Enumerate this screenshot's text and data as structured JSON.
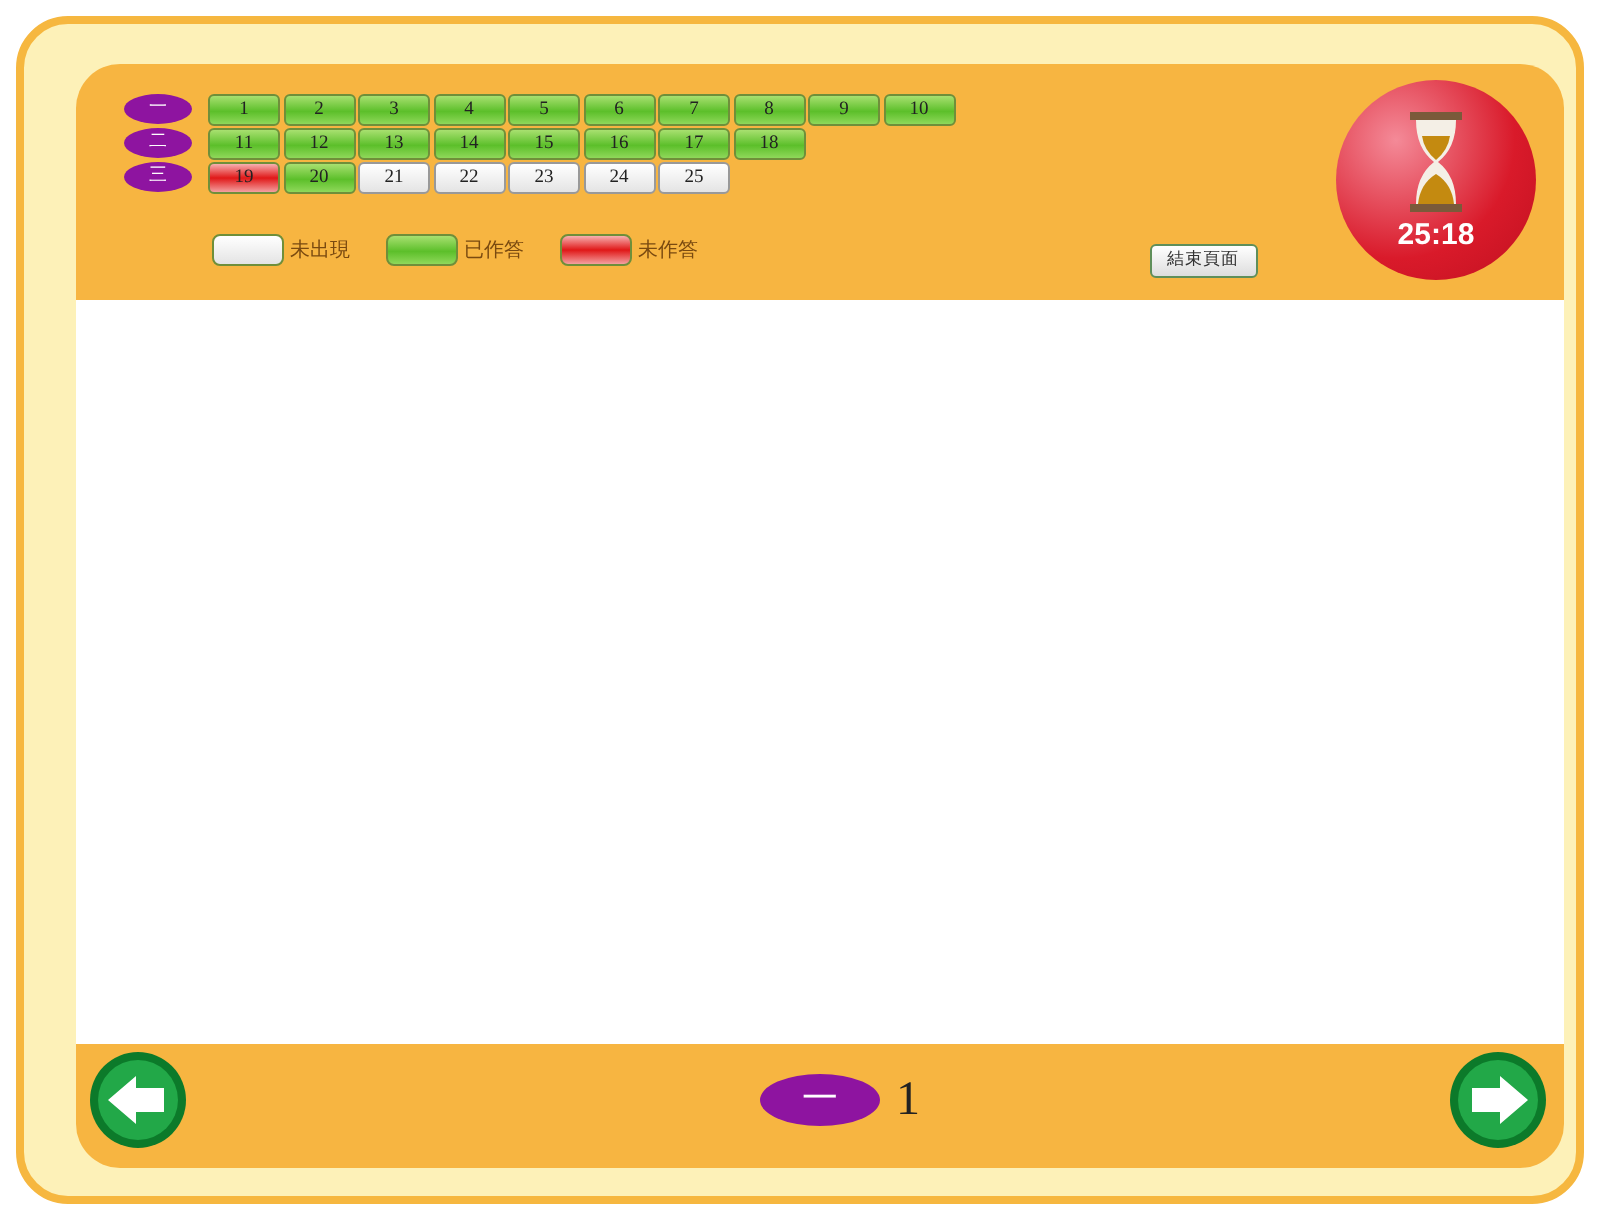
{
  "sections": [
    {
      "label": "一",
      "questions": [
        {
          "number": "1",
          "kind": "answered"
        },
        {
          "number": "2",
          "kind": "answered"
        },
        {
          "number": "3",
          "kind": "answered"
        },
        {
          "number": "4",
          "kind": "answered"
        },
        {
          "number": "5",
          "kind": "answered"
        },
        {
          "number": "6",
          "kind": "answered"
        },
        {
          "number": "7",
          "kind": "answered"
        },
        {
          "number": "8",
          "kind": "answered"
        },
        {
          "number": "9",
          "kind": "answered"
        },
        {
          "number": "10",
          "kind": "answered"
        }
      ]
    },
    {
      "label": "二",
      "questions": [
        {
          "number": "11",
          "kind": "answered"
        },
        {
          "number": "12",
          "kind": "answered"
        },
        {
          "number": "13",
          "kind": "answered"
        },
        {
          "number": "14",
          "kind": "answered"
        },
        {
          "number": "15",
          "kind": "answered"
        },
        {
          "number": "16",
          "kind": "answered"
        },
        {
          "number": "17",
          "kind": "answered"
        },
        {
          "number": "18",
          "kind": "answered"
        }
      ]
    },
    {
      "label": "三",
      "questions": [
        {
          "number": "19",
          "kind": "unanswered"
        },
        {
          "number": "20",
          "kind": "answered"
        },
        {
          "number": "21",
          "kind": "unseen"
        },
        {
          "number": "22",
          "kind": "unseen"
        },
        {
          "number": "23",
          "kind": "unseen"
        },
        {
          "number": "24",
          "kind": "unseen"
        },
        {
          "number": "25",
          "kind": "unseen"
        }
      ]
    }
  ],
  "legend": [
    {
      "kind": "unseen",
      "label": "未出現"
    },
    {
      "kind": "answered",
      "label": "已作答"
    },
    {
      "kind": "unanswered",
      "label": "未作答"
    }
  ],
  "end_button": "結束頁面",
  "timer": "25:18",
  "footer": {
    "section_label": "一",
    "question_number": "1"
  }
}
